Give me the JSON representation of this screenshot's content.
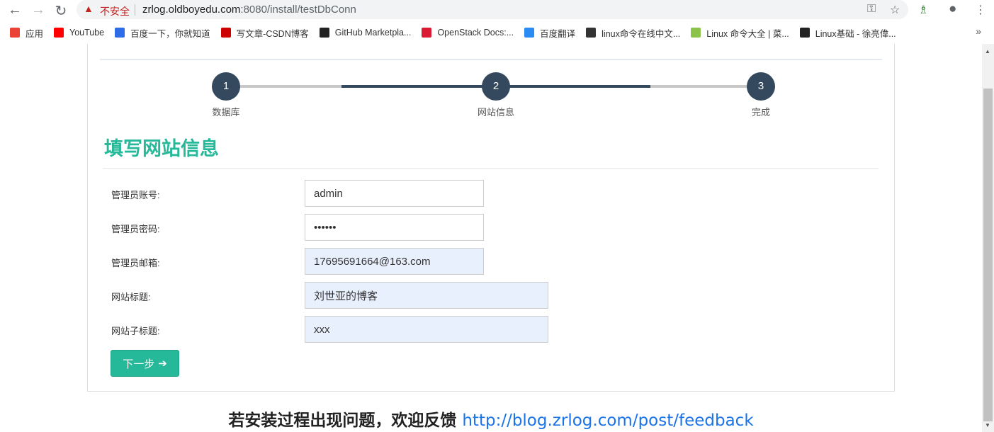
{
  "browser": {
    "insecure_label": "不安全",
    "url_host": "zrlog.oldboyedu.com",
    "url_path": ":8080/install/testDbConn",
    "bookmarks": [
      {
        "label": "应用",
        "icon": "apps-grid-icon",
        "color": "#ea4335"
      },
      {
        "label": "YouTube",
        "icon": "youtube-icon",
        "color": "#ff0000"
      },
      {
        "label": "百度一下，你就知道",
        "icon": "baidu-paw-icon",
        "color": "#2e6be6"
      },
      {
        "label": "写文章-CSDN博客",
        "icon": "csdn-icon",
        "color": "#c00"
      },
      {
        "label": "GitHub Marketpla...",
        "icon": "github-icon",
        "color": "#222"
      },
      {
        "label": "OpenStack Docs:...",
        "icon": "openstack-icon",
        "color": "#da1a32"
      },
      {
        "label": "百度翻译",
        "icon": "baidu-translate-icon",
        "color": "#2a8cf2"
      },
      {
        "label": "linux命令在线中文...",
        "icon": "tux-icon",
        "color": "#333"
      },
      {
        "label": "Linux 命令大全 | 菜...",
        "icon": "runoob-icon",
        "color": "#8bc34a"
      },
      {
        "label": "Linux基础 - 徐亮偉...",
        "icon": "site-icon",
        "color": "#222"
      }
    ]
  },
  "steps": [
    {
      "num": "1",
      "label": "数据库"
    },
    {
      "num": "2",
      "label": "网站信息"
    },
    {
      "num": "3",
      "label": "完成"
    }
  ],
  "colors": {
    "accent": "#26b999",
    "step": "#34495e"
  },
  "form": {
    "title": "填写网站信息",
    "fields": [
      {
        "label": "管理员账号:",
        "value": "admin"
      },
      {
        "label": "管理员密码:",
        "value": "••••••"
      },
      {
        "label": "管理员邮箱:",
        "value": "17695691664@163.com"
      },
      {
        "label": "网站标题:",
        "value": "刘世亚的博客"
      },
      {
        "label": "网站子标题:",
        "value": "xxx"
      }
    ],
    "next_label": "下一步"
  },
  "footer": {
    "text": "若安装过程出现问题，欢迎反馈 ",
    "link": "http://blog.zrlog.com/post/feedback"
  }
}
